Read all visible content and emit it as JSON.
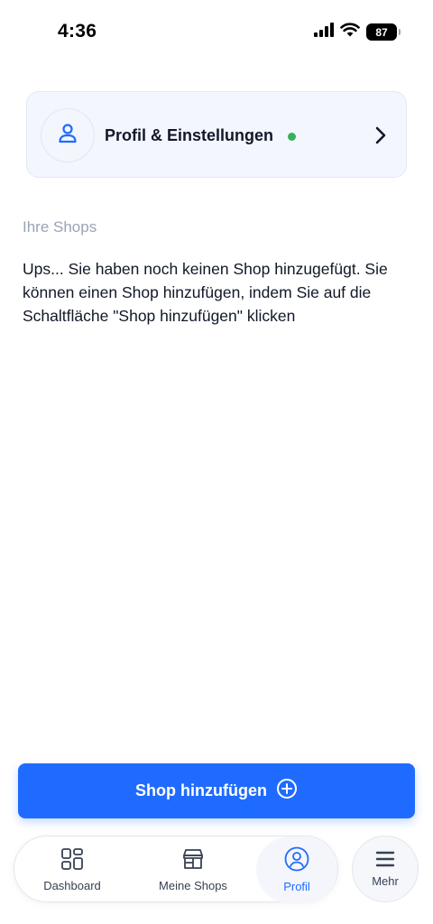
{
  "status_bar": {
    "time": "4:36",
    "battery": "87",
    "icons": [
      "signal-icon",
      "wifi-icon",
      "battery-icon"
    ]
  },
  "profile_card": {
    "label": "Profil & Einstellungen",
    "status_color": "#34b35a",
    "icon": "user-icon"
  },
  "shops": {
    "section_label": "Ihre Shops",
    "empty_message": "Ups... Sie haben noch keinen Shop hinzugefügt. Sie können einen Shop hinzufügen, indem Sie auf die Schaltfläche \"Shop hinzufügen\" klicken"
  },
  "add_shop_button": {
    "label": "Shop hinzufügen",
    "icon": "plus-circle-icon"
  },
  "bottom_nav": {
    "tabs": [
      {
        "label": "Dashboard",
        "icon": "dashboard-icon",
        "active": false
      },
      {
        "label": "Meine Shops",
        "icon": "store-icon",
        "active": false
      },
      {
        "label": "Profil",
        "icon": "profile-icon",
        "active": true
      }
    ],
    "more": {
      "label": "Mehr",
      "icon": "menu-icon"
    }
  },
  "colors": {
    "accent": "#1f6bff",
    "card_bg": "#f3f6fd",
    "muted_text": "#9aa3b5"
  }
}
